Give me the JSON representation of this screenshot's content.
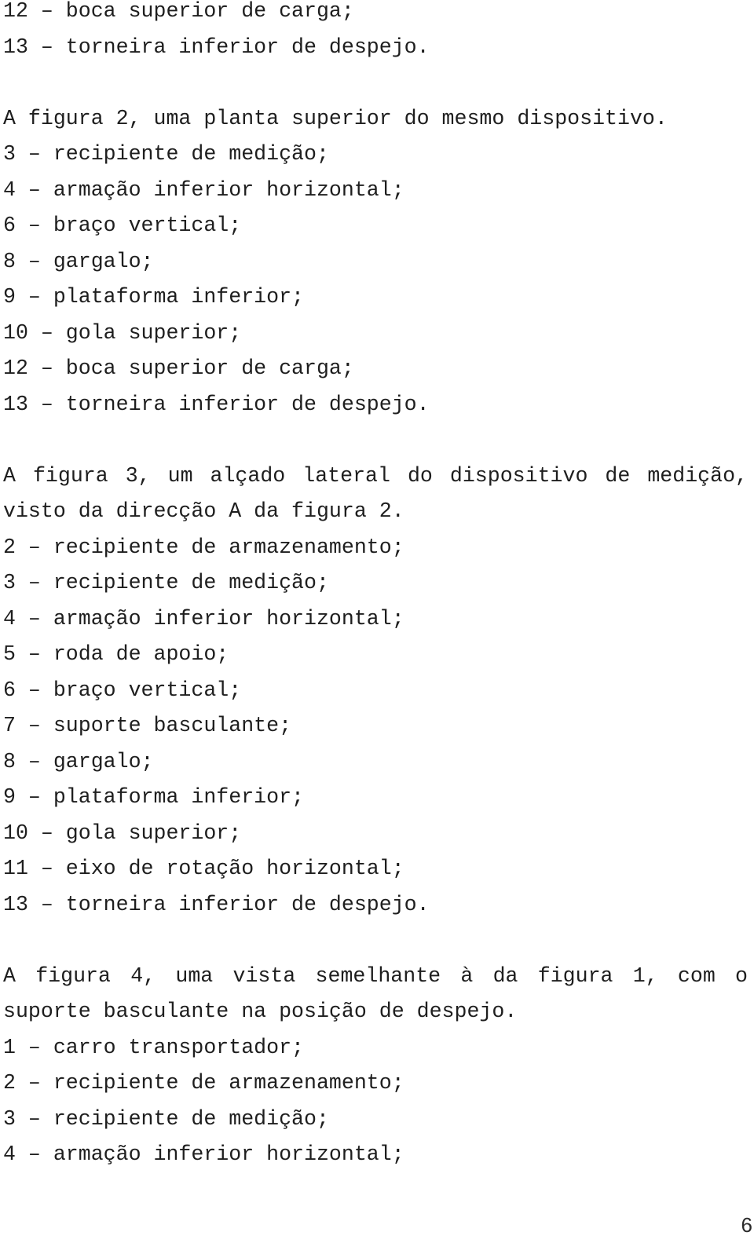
{
  "document": {
    "continued_list": [
      "12 – boca superior de carga;",
      "13 – torneira inferior de despejo."
    ],
    "figure2": {
      "caption": "A figura 2, uma planta superior do mesmo dispositivo.",
      "items": [
        "3 – recipiente de medição;",
        "4 – armação inferior horizontal;",
        "6 – braço vertical;",
        "8 – gargalo;",
        "9 – plataforma inferior;",
        "10 – gola superior;",
        "12 – boca superior de carga;",
        "13 – torneira inferior de despejo."
      ]
    },
    "figure3": {
      "caption_line1": "A figura 3, um alçado lateral do dispositivo de medição,",
      "caption_line2": "visto da direcção A da figura 2.",
      "items": [
        "2 – recipiente de armazenamento;",
        "3 – recipiente de medição;",
        "4 – armação inferior horizontal;",
        "5 – roda de apoio;",
        "6 – braço vertical;",
        "7 – suporte basculante;",
        "8 – gargalo;",
        "9 – plataforma inferior;",
        "10 – gola superior;",
        "11 – eixo de rotação horizontal;",
        "13 – torneira inferior de despejo."
      ]
    },
    "figure4": {
      "caption_line1": "A figura 4, uma vista semelhante à da figura 1, com o",
      "caption_line2": "suporte basculante na posição de despejo.",
      "items": [
        "1 – carro transportador;",
        "2 – recipiente de armazenamento;",
        "3 – recipiente de medição;",
        "4 – armação inferior horizontal;"
      ]
    },
    "page_number": "6"
  }
}
